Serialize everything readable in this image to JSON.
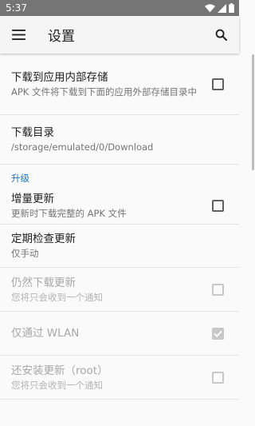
{
  "status_bar": {
    "time": "5:37"
  },
  "toolbar": {
    "title": "设置"
  },
  "preferences": [
    {
      "title": "下载到应用内部存储",
      "summary": "APK 文件将下载到下面的应用外部存储目录中",
      "checkbox": true,
      "checked": false,
      "enabled": true
    },
    {
      "title": "下载目录",
      "summary": "/storage/emulated/0/Download",
      "checkbox": false,
      "enabled": true
    }
  ],
  "upgrade_section": {
    "category_label": "升级",
    "items": [
      {
        "title": "增量更新",
        "summary": "更新时下载完整的 APK 文件",
        "checkbox": true,
        "checked": false,
        "enabled": true
      },
      {
        "title": "定期检查更新",
        "summary": "仅手动",
        "checkbox": false,
        "enabled": true
      },
      {
        "title": "仍然下载更新",
        "summary": "您将只会收到一个通知",
        "checkbox": true,
        "checked": false,
        "enabled": false
      },
      {
        "title": "仅通过 WLAN",
        "summary": "",
        "checkbox": true,
        "checked": true,
        "enabled": false
      },
      {
        "title": "还安装更新（root）",
        "summary": "您将只会收到一个通知",
        "checkbox": true,
        "checked": false,
        "enabled": false
      }
    ]
  },
  "colors": {
    "accent": "#1976d2",
    "status_bar": "#757575",
    "toolbar": "#f5f5f5",
    "background": "#fafafa"
  }
}
